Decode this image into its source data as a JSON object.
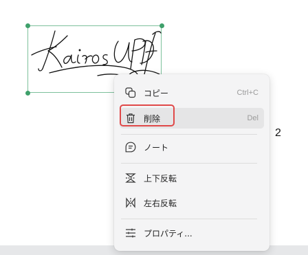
{
  "signature": {
    "text": "Kairos UPDF"
  },
  "menu": {
    "items": [
      {
        "label": "コピー",
        "shortcut": "Ctrl+C",
        "icon": "copy-icon"
      },
      {
        "label": "削除",
        "shortcut": "Del",
        "icon": "trash-icon"
      },
      {
        "label": "ノート",
        "shortcut": "",
        "icon": "note-icon"
      },
      {
        "label": "上下反転",
        "shortcut": "",
        "icon": "flip-vertical-icon"
      },
      {
        "label": "左右反転",
        "shortcut": "",
        "icon": "flip-horizontal-icon"
      },
      {
        "label": "プロパティ...",
        "shortcut": "",
        "icon": "properties-icon"
      }
    ]
  },
  "annotation": {
    "number": "2"
  },
  "colors": {
    "highlight": "#e04848",
    "selection": "#3fa06b"
  }
}
